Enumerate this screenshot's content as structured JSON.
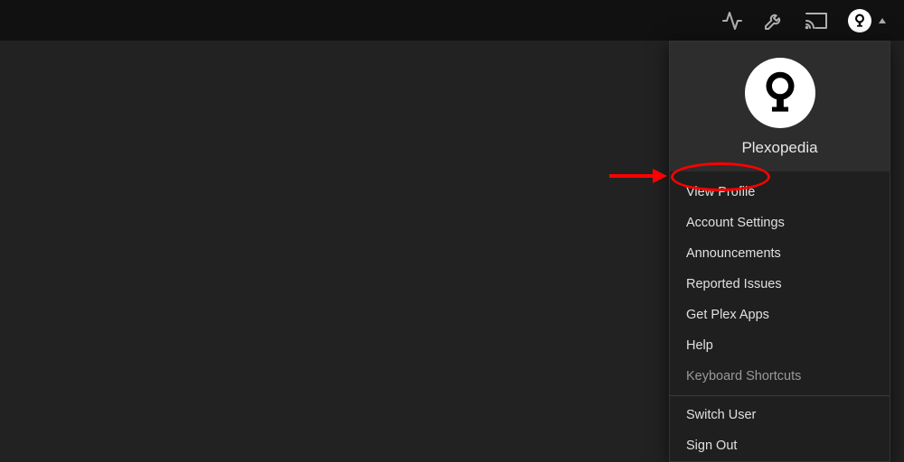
{
  "user": {
    "name": "Plexopedia"
  },
  "menu": {
    "view_profile": "View Profile",
    "account_settings": "Account Settings",
    "announcements": "Announcements",
    "reported_issues": "Reported Issues",
    "get_plex_apps": "Get Plex Apps",
    "help": "Help",
    "keyboard_shortcuts": "Keyboard Shortcuts",
    "switch_user": "Switch User",
    "sign_out": "Sign Out"
  }
}
